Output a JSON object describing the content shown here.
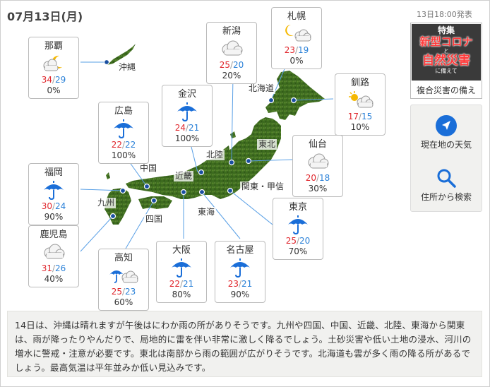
{
  "header": {
    "date": "07月13日(月)",
    "issued": "13日18:00発表"
  },
  "cities": [
    {
      "id": "naha",
      "name": "那覇",
      "icon": "sunny-cloudy-night-icon",
      "hi": "34",
      "lo": "29",
      "pop": "0%"
    },
    {
      "id": "sapporo",
      "name": "札幌",
      "icon": "night-then-cloudy-icon",
      "hi": "23",
      "lo": "19",
      "pop": "0%"
    },
    {
      "id": "niigata",
      "name": "新潟",
      "icon": "cloudy-icon",
      "hi": "25",
      "lo": "20",
      "pop": "20%"
    },
    {
      "id": "kanazawa",
      "name": "金沢",
      "icon": "umbrella-icon",
      "hi": "24",
      "lo": "21",
      "pop": "100%"
    },
    {
      "id": "hiroshima",
      "name": "広島",
      "icon": "umbrella-icon",
      "hi": "22",
      "lo": "22",
      "pop": "100%"
    },
    {
      "id": "kushiro",
      "name": "釧路",
      "icon": "sunny-cloudy-icon",
      "hi": "17",
      "lo": "15",
      "pop": "10%"
    },
    {
      "id": "sendai",
      "name": "仙台",
      "icon": "cloudy-icon",
      "hi": "20",
      "lo": "18",
      "pop": "30%"
    },
    {
      "id": "fukuoka",
      "name": "福岡",
      "icon": "umbrella-icon",
      "hi": "30",
      "lo": "24",
      "pop": "90%"
    },
    {
      "id": "tokyo",
      "name": "東京",
      "icon": "umbrella-icon",
      "hi": "25",
      "lo": "20",
      "pop": "70%"
    },
    {
      "id": "kagoshima",
      "name": "鹿児島",
      "icon": "cloudy-icon",
      "hi": "31",
      "lo": "26",
      "pop": "40%"
    },
    {
      "id": "kochi",
      "name": "高知",
      "icon": "rain-then-cloudy-icon",
      "hi": "25",
      "lo": "23",
      "pop": "60%"
    },
    {
      "id": "osaka",
      "name": "大阪",
      "icon": "umbrella-icon",
      "hi": "22",
      "lo": "21",
      "pop": "80%"
    },
    {
      "id": "nagoya",
      "name": "名古屋",
      "icon": "umbrella-icon",
      "hi": "23",
      "lo": "21",
      "pop": "90%"
    }
  ],
  "temp_separator": "/",
  "regions": {
    "okinawa": "沖縄",
    "hokkaido": "北海道",
    "tohoku": "東北",
    "hokuriku": "北陸",
    "chugoku": "中国",
    "kinki": "近畿",
    "kanto": "関東・甲信",
    "kyushu": "九州",
    "shikoku": "四国",
    "tokai": "東海"
  },
  "banner": {
    "tag": "特集",
    "line1": "新型コロナ",
    "connector": "と",
    "line2": "自然災害",
    "suffix": "に備えて",
    "caption": "複合災害の備え"
  },
  "tools": {
    "current_location": "現在地の天気",
    "address_search": "住所から検索"
  },
  "colors": {
    "high_temp": "#e0262c",
    "low_temp": "#2c82d8",
    "umbrella": "#1a6ed8",
    "location_icon": "#1a6ed8"
  },
  "description": "14日は、沖縄は晴れますが午後はにわか雨の所がありそうです。九州や四国、中国、近畿、北陸、東海から関東は、雨が降ったりやんだりで、局地的に雷を伴い非常に激しく降るでしょう。土砂災害や低い土地の浸水、河川の増水に警戒・注意が必要です。東北は南部から雨の範囲が広がりそうです。北海道も雲が多く雨の降る所があるでしょう。最高気温は平年並みか低い見込みです。"
}
